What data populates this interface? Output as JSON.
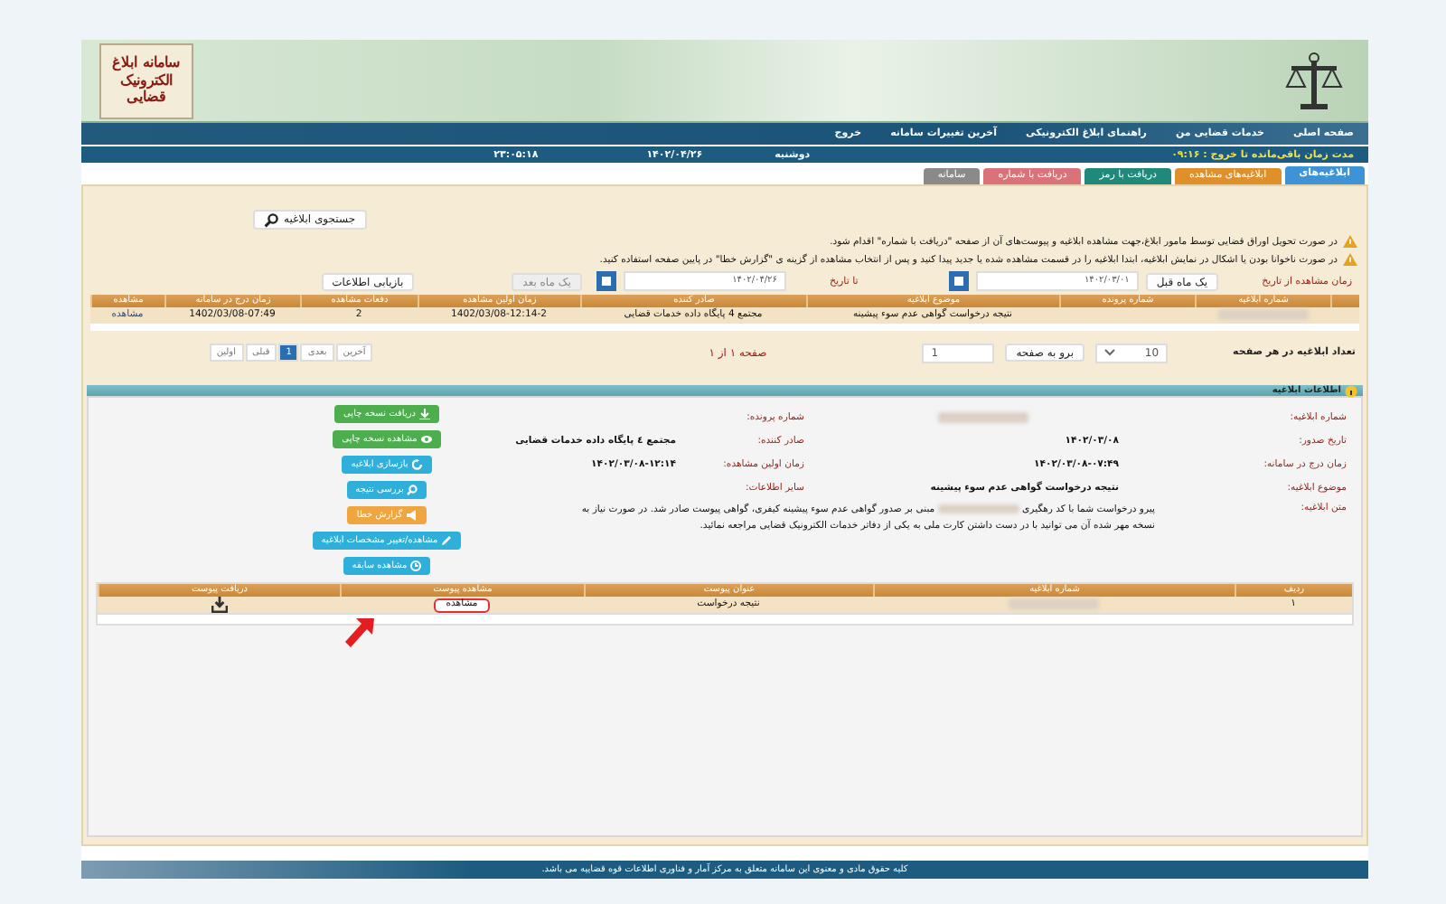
{
  "header": {
    "logo_text": "سامانه ابلاغ الکترونیک قضایی"
  },
  "nav": [
    "صفحه اصلی",
    "خدمات قضایی من",
    "راهنمای ابلاغ الکترونیکی",
    "آخرین تغییرات سامانه",
    "خروج"
  ],
  "session": {
    "label": "مدت زمان باقی‌مانده تا خروج :",
    "remaining": "۰۹:۱۶",
    "weekday": "دوشنبه",
    "date": "۱۴۰۲/۰۴/۲۶",
    "time": "۲۳:۰۵:۱۸"
  },
  "tabs": [
    {
      "label": "ابلاغیه‌های",
      "color": "#3d93d6",
      "selected": true
    },
    {
      "label": "ابلاغیه‌های مشاهده",
      "color": "#e0902a",
      "selected": false
    },
    {
      "label": "دریافت با رمز",
      "color": "#1f8a7a",
      "selected": false
    },
    {
      "label": "دریافت با شماره",
      "color": "#d9727a",
      "selected": false
    },
    {
      "label": "سامانه",
      "color": "#8a8a8a",
      "selected": false
    }
  ],
  "search_button": "جستجوی ابلاغیه",
  "notices": [
    "در صورت تحویل اوراق قضایی توسط مامور ابلاغ،جهت مشاهده ابلاغیه و پیوست‌های آن از صفحه \"دریافت با شماره\" اقدام شود.",
    "در صورت ناخوانا بودن یا اشکال در نمایش ابلاغیه، ابتدا ابلاغیه را در قسمت مشاهده شده یا جدید پیدا کنید و پس از انتخاب مشاهده از گزینه ی \"گزارش خطا\" در پایین صفحه استفاده کنید."
  ],
  "filter": {
    "from_label": "زمان مشاهده از تاریخ",
    "prev_month": "یک ماه قبل",
    "from_date": "۱۴۰۲/۰۳/۰۱",
    "to_label": "تا تاریخ",
    "to_date": "۱۴۰۲/۰۴/۲۶",
    "next_month": {
      "label": "یک ماه بعد",
      "disabled": true
    },
    "refresh": "بازیابی اطلاعات"
  },
  "table": {
    "columns": [
      "شماره ابلاغیه",
      "شماره پرونده",
      "موضوع ابلاغیه",
      "صادر کننده",
      "زمان اولین مشاهده",
      "دفعات مشاهده",
      "زمان درج در سامانه",
      "مشاهده"
    ],
    "rows": [
      {
        "cells": [
          {
            "kind": "blurred"
          },
          {
            "kind": "empty"
          },
          {
            "kind": "text",
            "text": "نتیجه درخواست گواهی عدم سوء پیشینه"
          },
          {
            "kind": "text",
            "text": "مجتمع 4 پایگاه داده خدمات قضایی"
          },
          {
            "kind": "text",
            "text": "1402/03/08-12:14-2"
          },
          {
            "kind": "text",
            "text": "2"
          },
          {
            "kind": "text",
            "text": "1402/03/08-07:49"
          },
          {
            "kind": "link",
            "text": "مشاهده"
          }
        ]
      }
    ]
  },
  "pagination": {
    "per_page_label": "تعداد ابلاغیه در هر صفحه",
    "per_page": "10",
    "go_button": "برو به صفحه",
    "page_input": "1",
    "page_info": "صفحه ۱ از ۱",
    "pages": [
      {
        "label": "آخرین",
        "selected": false
      },
      {
        "label": "بعدی",
        "selected": false
      },
      {
        "label": "1",
        "selected": true
      },
      {
        "label": "قبلی",
        "selected": false
      },
      {
        "label": "اولین",
        "selected": false
      }
    ]
  },
  "details": {
    "title": "اطلاعات ابلاغیه",
    "fields": [
      {
        "label": "شماره ابلاغیه:",
        "kind": "blurred"
      },
      {
        "label": "شماره پرونده:",
        "kind": "empty"
      },
      {
        "label": "تاریخ صدور:",
        "kind": "text",
        "value": "۱۴۰۲/۰۳/۰۸"
      },
      {
        "label": "صادر کننده:",
        "kind": "text",
        "value": "مجتمع ٤ پایگاه داده خدمات قضایی"
      },
      {
        "label": "زمان درج در سامانه:",
        "kind": "text",
        "value": "۱۴۰۲/۰۳/۰۸-۰۷:۴۹"
      },
      {
        "label": "زمان اولین مشاهده:",
        "kind": "text",
        "value": "۱۴۰۲/۰۳/۰۸-۱۲:۱۴"
      },
      {
        "label": "موضوع ابلاغیه:",
        "kind": "text",
        "value": "نتیجه درخواست گواهی عدم سوء پیشینه"
      },
      {
        "label": "سایر اطلاعات:",
        "kind": "empty"
      }
    ],
    "message": {
      "label": "متن ابلاغیه:",
      "before": "پیرو درخواست شما با کد رهگیری",
      "after": "مبنی بر صدور گواهی عدم سوء پیشینه کیفری، گواهی پیوست صادر شد. در صورت نیاز به نسخه مهر شده آن می توانید با در دست داشتن کارت ملی به یکی از دفاتر خدمات الکترونیک قضایی مراجعه نمائید."
    },
    "actions": [
      {
        "label": "دریافت نسخه چاپی",
        "color": "#4cae4c"
      },
      {
        "label": "مشاهده نسخه چاپی",
        "color": "#4cae4c"
      },
      {
        "label": "بازسازی ابلاغیه",
        "color": "#2fb0da"
      },
      {
        "label": "بررسی نتیجه",
        "color": "#2fb0da"
      },
      {
        "label": "گزارش خطا",
        "color": "#f0a640"
      },
      {
        "label": "مشاهده/تغییر مشخصات ابلاغیه",
        "color": "#2fb0da"
      },
      {
        "label": "مشاهده سابقه",
        "color": "#2fb0da"
      }
    ]
  },
  "attachments": {
    "columns": [
      "ردیف",
      "شماره ابلاغیه",
      "عنوان پیوست",
      "مشاهده پیوست",
      "دریافت پیوست"
    ],
    "rows": [
      {
        "number": "۱",
        "title": "نتیجه درخواست",
        "view": "مشاهده",
        "highlighted": true
      }
    ]
  },
  "annotation_arrow": true,
  "footer": "کلیه حقوق مادی و معنوی این سامانه متعلق به مرکز آمار و فناوری اطلاعات قوه قضاییه می باشد."
}
